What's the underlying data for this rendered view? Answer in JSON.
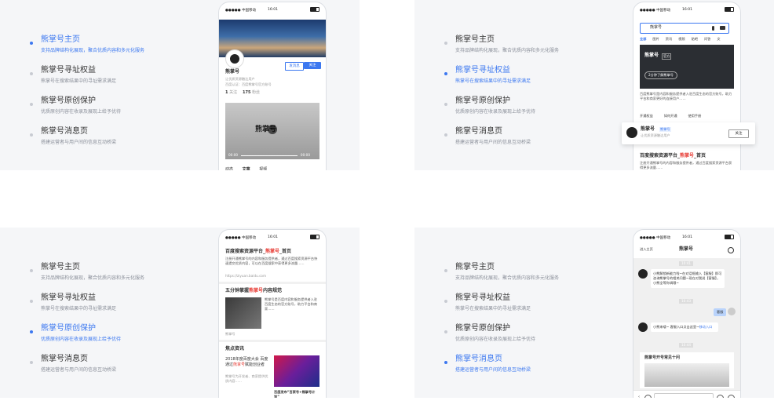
{
  "panels": [
    {
      "menu": [
        {
          "title": "熊掌号主页",
          "sub": "支持品牌结构化展现，聚合优质内容和多元化服务"
        },
        {
          "title": "熊掌号寻址权益",
          "sub": "熊掌号在搜索结果中的寻址需求满足"
        },
        {
          "title": "熊掌号原创保护",
          "sub": "优质原创内容在收录及展现上给予优待"
        },
        {
          "title": "熊掌号消息页",
          "sub": "搭建运营者与用户间的信息互动桥梁"
        }
      ],
      "active": 0
    },
    {
      "menu": [
        {
          "title": "熊掌号主页",
          "sub": "支持品牌结构化展现，聚合优质内容和多元化服务"
        },
        {
          "title": "熊掌号寻址权益",
          "sub": "熊掌号在搜索结果中的寻址需求满足"
        },
        {
          "title": "熊掌号原创保护",
          "sub": "优质原创内容在收录及展现上给予优待"
        },
        {
          "title": "熊掌号消息页",
          "sub": "搭建运营者与用户间的信息互动桥梁"
        }
      ],
      "active": 1
    },
    {
      "menu": [
        {
          "title": "熊掌号主页",
          "sub": "支持品牌结构化展现，聚合优质内容和多元化服务"
        },
        {
          "title": "熊掌号寻址权益",
          "sub": "熊掌号在搜索结果中的寻址需求满足"
        },
        {
          "title": "熊掌号原创保护",
          "sub": "优质原创内容在收录及展现上给予优待"
        },
        {
          "title": "熊掌号消息页",
          "sub": "搭建运营者与用户间的信息互动桥梁"
        }
      ],
      "active": 2
    },
    {
      "menu": [
        {
          "title": "熊掌号主页",
          "sub": "支持品牌结构化展现，聚合优质内容和多元化服务"
        },
        {
          "title": "熊掌号寻址权益",
          "sub": "熊掌号在搜索结果中的寻址需求满足"
        },
        {
          "title": "熊掌号原创保护",
          "sub": "优质原创内容在收录及展现上给予优待"
        },
        {
          "title": "熊掌号消息页",
          "sub": "搭建运营者与用户间的信息互动桥梁"
        }
      ],
      "active": 3
    }
  ],
  "status": {
    "carrier": "●●●●● 中国移动",
    "time": "16:01"
  },
  "phone1": {
    "name": "熊掌号",
    "desc": "让优质资源触达用户",
    "cert": "百度认证：百度熊掌号官方账号",
    "follow_count": "1",
    "follow_label": "关注",
    "fans_count": "175",
    "fans_label": "粉丝",
    "btn_msg": "发消息",
    "btn_follow": "关注",
    "video_title": "熊掌号",
    "video_time_left": "00:00",
    "video_time_right": "00:00",
    "tabs": [
      "动态",
      "文章",
      "视频"
    ]
  },
  "phone2": {
    "query": "熊掌号",
    "tabs": [
      "全部",
      "图片",
      "资讯",
      "视频",
      "贴吧",
      "问答",
      "文"
    ],
    "card_title": "熊掌号",
    "card_badge": "官方",
    "card_link": "2分钟了解熊掌号",
    "card_desc": "百度熊掌号是内容和服务提供者入驻百度生态的官方账号，助力平台和商家更好的连接用户……",
    "actions": [
      "开通权益",
      "如何开通",
      "使用手册"
    ],
    "popup_name": "熊掌号",
    "popup_tag": "熊掌号",
    "popup_sub": "让优质资源触达用户",
    "popup_btn": "关注",
    "result_title_a": "百度搜索资源平台_",
    "result_title_b": "熊掌号",
    "result_title_c": "_首页",
    "result_desc": "注册开通熊掌号的内容和服务提供者，通过百度搜索资源平台获得更多流量……"
  },
  "phone3": {
    "r1_title_a": "百度搜索资源平台_",
    "r1_title_b": "熊掌号",
    "r1_title_c": "_首页",
    "r1_desc": "注册开通熊掌号的内容和服务提供者，通过百度搜索资源平台快速提交优质内容，可以在百度搜索中获得更多流量……",
    "r1_url": "https://ziyuan.baidu.com",
    "r2_title_a": "五分钟掌握",
    "r2_title_b": "熊掌号",
    "r2_title_c": "内容规范",
    "r2_desc": "熊掌号是百度内容和服务提供者入驻百度生态的官方账号，助力平台和商家……",
    "r2_source": "熊掌号",
    "focus_label": "焦点资讯",
    "f1_title_a": "2018年度百度大会 百度通过",
    "f1_title_b": "熊掌号",
    "f1_title_c": "赋能创业者",
    "f1_desc": "熊掌号为开发者、商家提供优质内容……",
    "f2_title": "百度发布“百家号+熊掌号计划”"
  },
  "phone4": {
    "back": "进入主页",
    "title": "熊掌号",
    "time1": "10:41",
    "msg1": "小熊解锁新能力啦~在对话框输入【客服】即可咨询熊掌号的相关问题~现在对我说【客服】，小熊全等你调哦~",
    "time2": "10:43",
    "user_msg": "客服",
    "msg2": "小熊来喽~ 客服入口点击这里~",
    "msg2_link": "移动入口",
    "time3": "10:44",
    "card_title": "熊掌号开号常见十问"
  },
  "colors": {
    "accent": "#3c78f0",
    "panel_bg": "#f5f6f8",
    "highlight": "#e8413a"
  }
}
